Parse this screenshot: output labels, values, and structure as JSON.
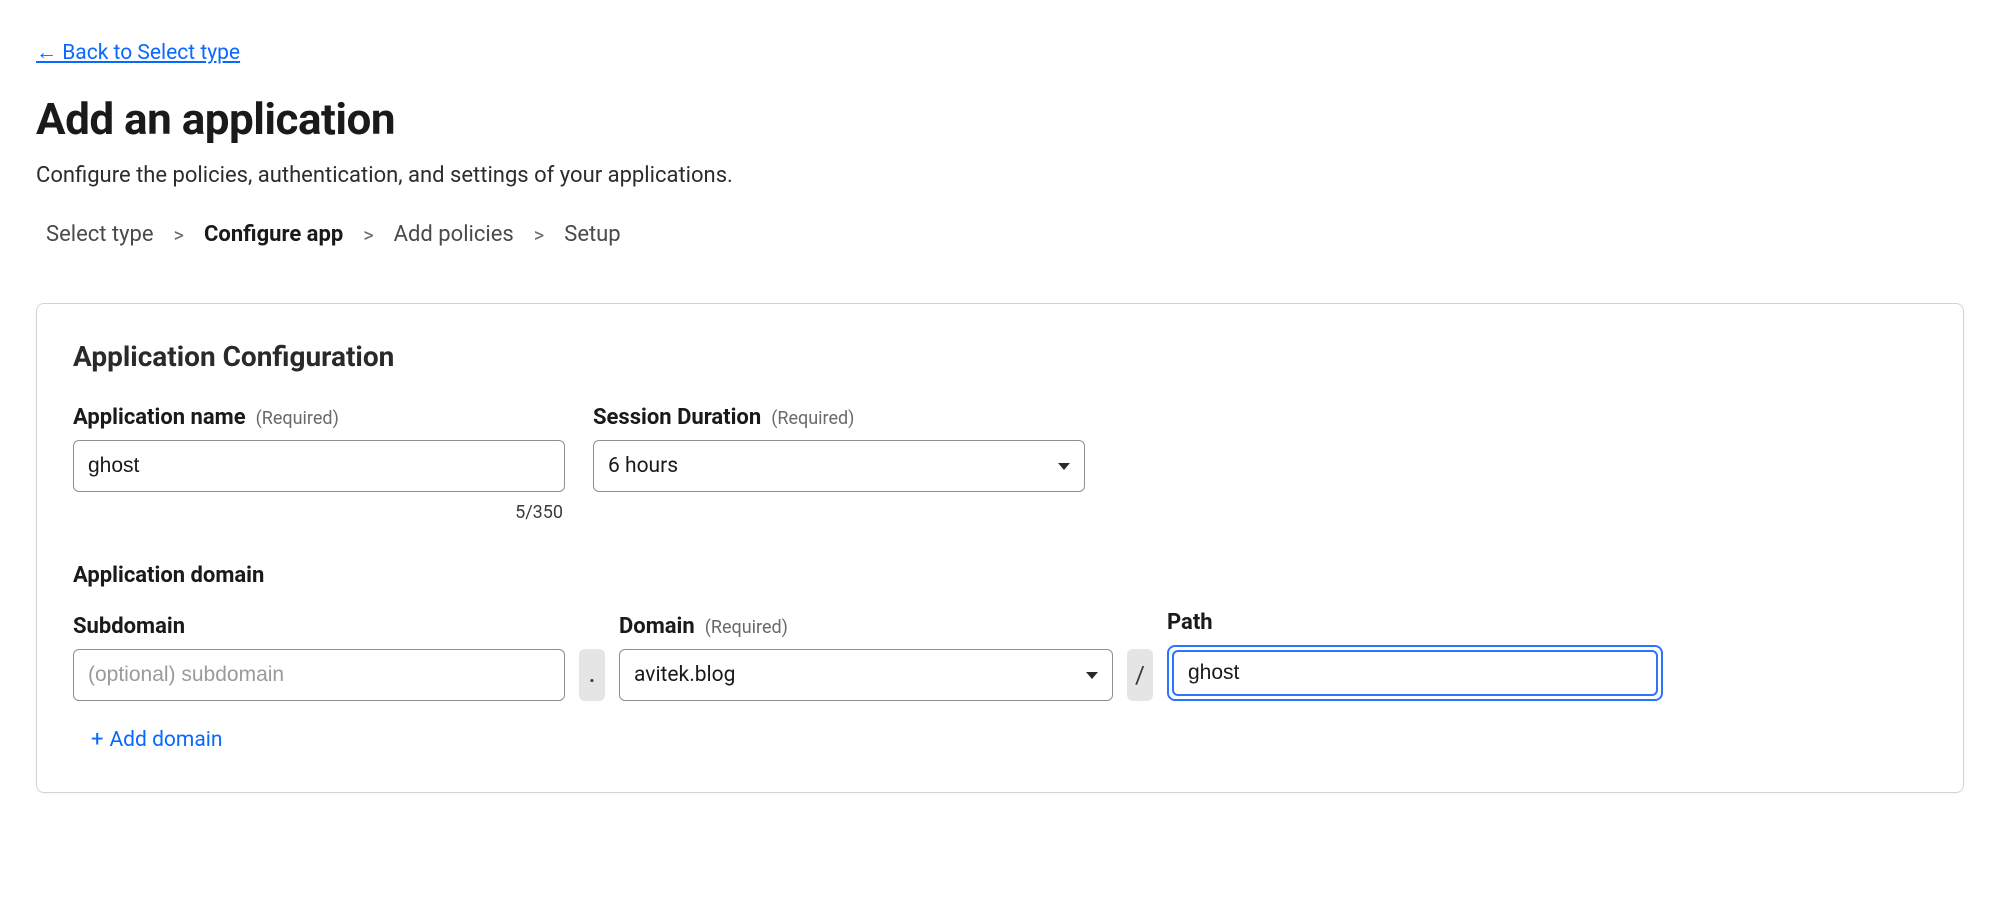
{
  "header": {
    "back_link": "← Back to Select type",
    "title": "Add an application",
    "subtitle": "Configure the policies, authentication, and settings of your applications."
  },
  "breadcrumb": {
    "steps": [
      "Select type",
      "Configure app",
      "Add policies",
      "Setup"
    ],
    "active_index": 1,
    "separator": ">"
  },
  "card": {
    "title": "Application Configuration",
    "app_name": {
      "label": "Application name",
      "required": "Required",
      "value": "ghost",
      "char_count": "5/350"
    },
    "session_duration": {
      "label": "Session Duration",
      "required": "Required",
      "value": "6 hours"
    },
    "domain": {
      "section_label": "Application domain",
      "subdomain": {
        "label": "Subdomain",
        "placeholder": "(optional) subdomain",
        "value": ""
      },
      "domain": {
        "label": "Domain",
        "required": "Required",
        "value": "avitek.blog"
      },
      "path": {
        "label": "Path",
        "value": "ghost"
      },
      "dot": ".",
      "slash": "/",
      "add_domain_label": "Add domain",
      "add_domain_plus": "+"
    }
  }
}
